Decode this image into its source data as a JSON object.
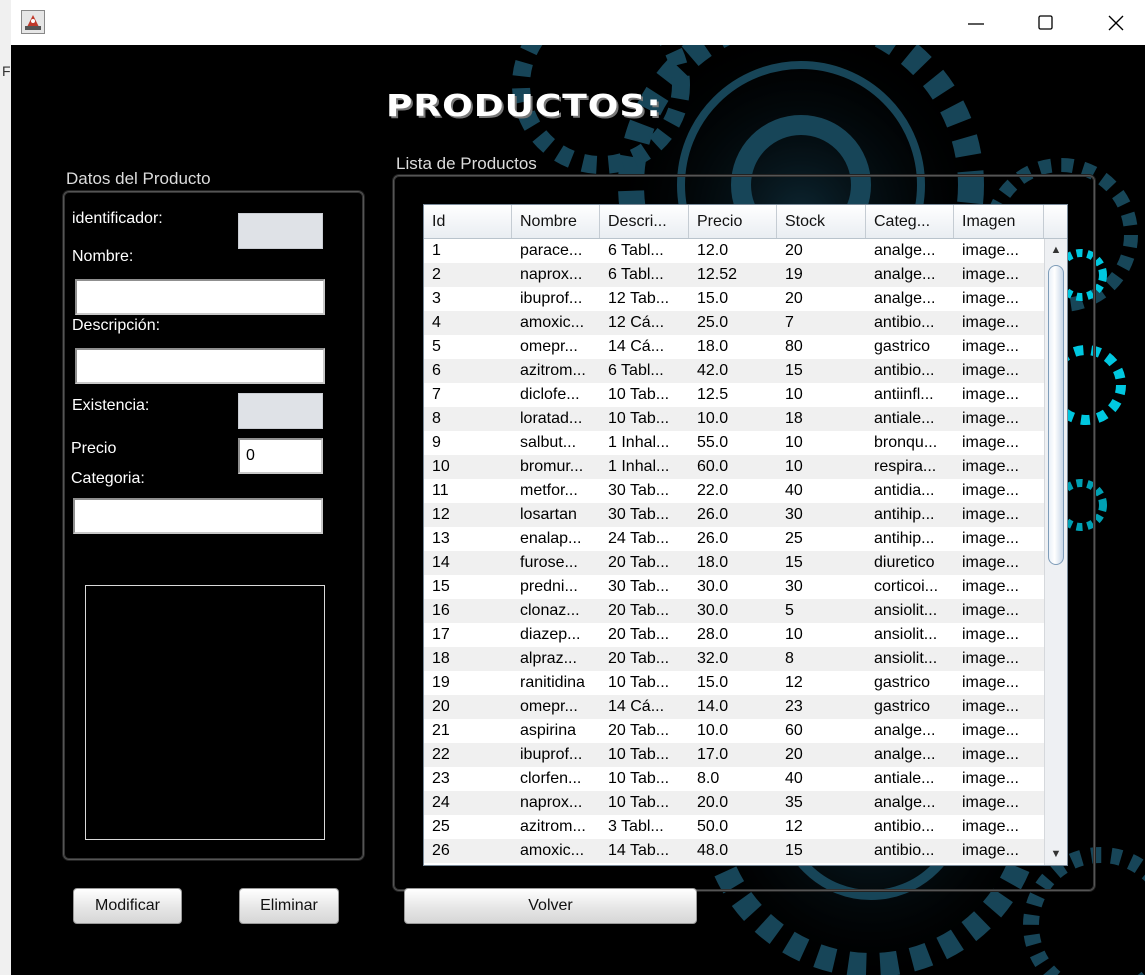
{
  "window": {
    "title": "",
    "frame_glyph": "F"
  },
  "icons": {
    "app": "java-app-icon",
    "minimize": "minimize-icon",
    "maximize": "maximize-icon",
    "close": "close-icon"
  },
  "page": {
    "title": "PRODUCTOS:"
  },
  "form": {
    "title": "Datos del Producto",
    "identificador_label": "identificador:",
    "identificador_value": "",
    "nombre_label": "Nombre:",
    "nombre_value": "",
    "descripcion_label": "Descripción:",
    "descripcion_value": "",
    "existencia_label": "Existencia:",
    "existencia_value": "",
    "precio_label": "Precio",
    "precio_value": "0",
    "categoria_label": "Categoria:",
    "categoria_value": ""
  },
  "list": {
    "title": "Lista de Productos",
    "columns": [
      "Id",
      "Nombre",
      "Descri...",
      "Precio",
      "Stock",
      "Categ...",
      "Imagen"
    ],
    "rows": [
      [
        "1",
        "parace...",
        "6 Tabl...",
        "12.0",
        "20",
        "analge...",
        "image..."
      ],
      [
        "2",
        "naprox...",
        "6 Tabl...",
        "12.52",
        "19",
        "analge...",
        "image..."
      ],
      [
        "3",
        "ibuprof...",
        "12 Tab...",
        "15.0",
        "20",
        "analge...",
        "image..."
      ],
      [
        "4",
        "amoxic...",
        "12 Cá...",
        "25.0",
        "7",
        "antibio...",
        "image..."
      ],
      [
        "5",
        "omepr...",
        "14 Cá...",
        "18.0",
        "80",
        "gastrico",
        "image..."
      ],
      [
        "6",
        "azitrom...",
        "6 Tabl...",
        "42.0",
        "15",
        "antibio...",
        "image..."
      ],
      [
        "7",
        "diclofe...",
        "10 Tab...",
        "12.5",
        "10",
        "antiinfl...",
        "image..."
      ],
      [
        "8",
        "loratad...",
        "10 Tab...",
        "10.0",
        "18",
        "antiale...",
        "image..."
      ],
      [
        "9",
        "salbut...",
        "1 Inhal...",
        "55.0",
        "10",
        "bronqu...",
        "image..."
      ],
      [
        "10",
        "bromur...",
        "1 Inhal...",
        "60.0",
        "10",
        "respira...",
        "image..."
      ],
      [
        "11",
        "metfor...",
        "30 Tab...",
        "22.0",
        "40",
        "antidia...",
        "image..."
      ],
      [
        "12",
        "losartan",
        "30 Tab...",
        "26.0",
        "30",
        "antihip...",
        "image..."
      ],
      [
        "13",
        "enalap...",
        "24 Tab...",
        "26.0",
        "25",
        "antihip...",
        "image..."
      ],
      [
        "14",
        "furose...",
        "20 Tab...",
        "18.0",
        "15",
        "diuretico",
        "image..."
      ],
      [
        "15",
        "predni...",
        "30 Tab...",
        "30.0",
        "30",
        "corticoi...",
        "image..."
      ],
      [
        "16",
        "clonaz...",
        "20 Tab...",
        "30.0",
        "5",
        "ansiolit...",
        "image..."
      ],
      [
        "17",
        "diazep...",
        "20 Tab...",
        "28.0",
        "10",
        "ansiolit...",
        "image..."
      ],
      [
        "18",
        "alpraz...",
        "20 Tab...",
        "32.0",
        "8",
        "ansiolit...",
        "image..."
      ],
      [
        "19",
        "ranitidina",
        "10 Tab...",
        "15.0",
        "12",
        "gastrico",
        "image..."
      ],
      [
        "20",
        "omepr...",
        "14 Cá...",
        "14.0",
        "23",
        "gastrico",
        "image..."
      ],
      [
        "21",
        "aspirina",
        "20 Tab...",
        "10.0",
        "60",
        "analge...",
        "image..."
      ],
      [
        "22",
        "ibuprof...",
        "10 Tab...",
        "17.0",
        "20",
        "analge...",
        "image..."
      ],
      [
        "23",
        "clorfen...",
        "10 Tab...",
        "8.0",
        "40",
        "antiale...",
        "image..."
      ],
      [
        "24",
        "naprox...",
        "10 Tab...",
        "20.0",
        "35",
        "analge...",
        "image..."
      ],
      [
        "25",
        "azitrom...",
        "3 Tabl...",
        "50.0",
        "12",
        "antibio...",
        "image..."
      ],
      [
        "26",
        "amoxic...",
        "14 Tab...",
        "48.0",
        "15",
        "antibio...",
        "image..."
      ]
    ]
  },
  "buttons": {
    "modificar": "Modificar",
    "eliminar": "Eliminar",
    "volver": "Volver"
  },
  "colors": {
    "background": "#000000",
    "gear_accent": "#00c8e0",
    "text": "#ffffff"
  }
}
